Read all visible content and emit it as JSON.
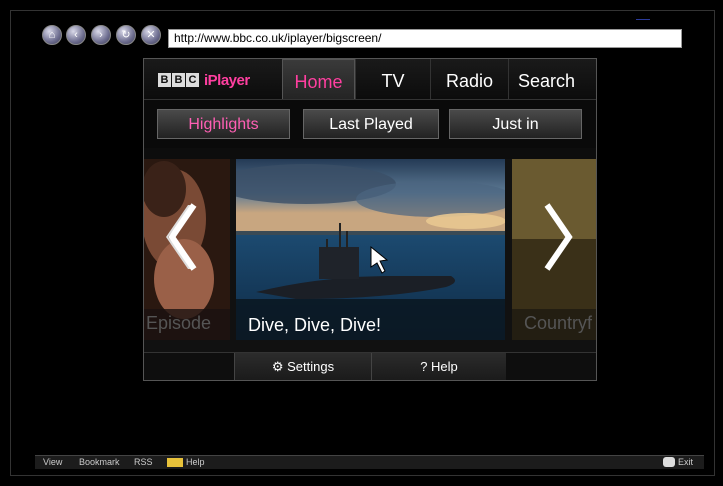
{
  "browser": {
    "url": "http://www.bbc.co.uk/iplayer/bigscreen/",
    "nav_icons": [
      "home-icon",
      "back-icon",
      "forward-icon",
      "reload-icon",
      "stop-icon"
    ]
  },
  "iplayer": {
    "logo_letters": [
      "B",
      "B",
      "C"
    ],
    "logo_text": "iPlayer",
    "tabs": [
      {
        "label": "Home"
      },
      {
        "label": "TV"
      },
      {
        "label": "Radio"
      },
      {
        "label": "Search"
      }
    ],
    "subnav": [
      {
        "label": "Highlights"
      },
      {
        "label": "Last Played"
      },
      {
        "label": "Just in"
      }
    ],
    "carousel": {
      "left_label": "Episode",
      "main_label": "Dive, Dive, Dive!",
      "right_label": "Countryf"
    },
    "bottom": {
      "settings": "Settings",
      "help_prefix": "?",
      "help": "Help"
    }
  },
  "statusbar": {
    "view": "View",
    "bookmark": "Bookmark",
    "rss": "RSS",
    "help": "Help",
    "exit": "Exit"
  },
  "colors": {
    "accent": "#ff3fa0",
    "background": "#000000"
  }
}
